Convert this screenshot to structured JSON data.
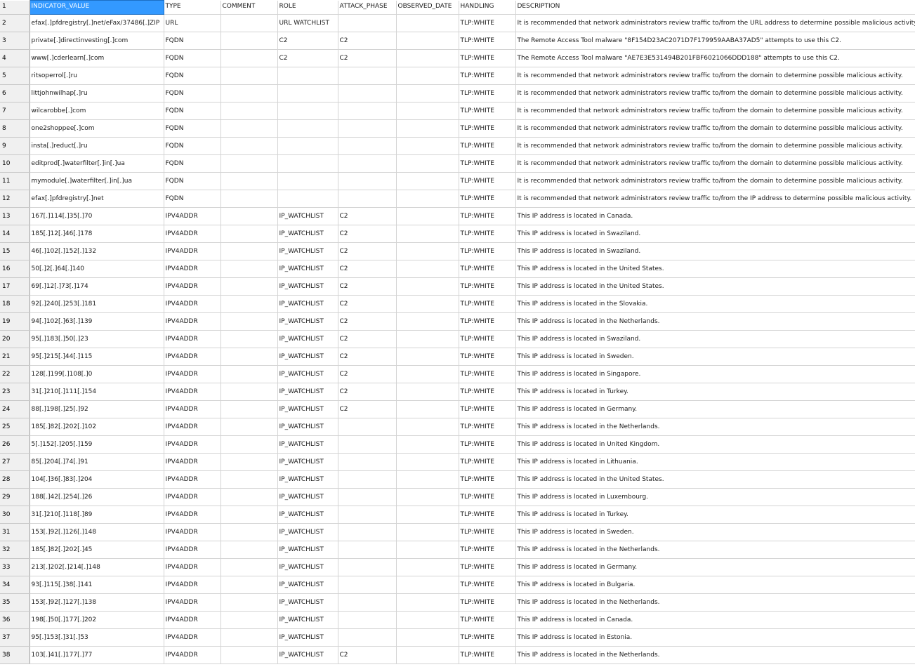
{
  "row_numbers": [
    "1",
    "2",
    "3",
    "4",
    "5",
    "6",
    "7",
    "8",
    "9",
    "10",
    "11",
    "12",
    "13",
    "14",
    "15",
    "16",
    "17",
    "18",
    "19",
    "20",
    "21",
    "22",
    "23",
    "24",
    "25",
    "26",
    "27",
    "28",
    "29",
    "30",
    "31",
    "32",
    "33",
    "34",
    "35",
    "36",
    "37",
    "38"
  ],
  "columns": [
    "INDICATOR_VALUE",
    "TYPE",
    "COMMENT",
    "ROLE",
    "ATTACK_PHASE",
    "OBSERVED_DATE",
    "HANDLING",
    "DESCRIPTION"
  ],
  "rows": [
    [
      "efax[.]pfdregistry[.]net/eFax/37486[.]ZIP",
      "URL",
      "",
      "URL WATCHLIST",
      "",
      "",
      "TLP:WHITE",
      "It is recommended that network administrators review traffic to/from the URL address to determine possible malicious activity."
    ],
    [
      "private[.]directinvesting[.]com",
      "FQDN",
      "",
      "C2",
      "C2",
      "",
      "TLP:WHITE",
      "The Remote Access Tool malware \"8F154D23AC2071D7F179959AABA37AD5\" attempts to use this C2."
    ],
    [
      "www[.]cderlearn[.]com",
      "FQDN",
      "",
      "C2",
      "C2",
      "",
      "TLP:WHITE",
      "The Remote Access Tool malware \"AE7E3E531494B201FBF6021066DDD188\" attempts to use this C2."
    ],
    [
      "ritsoperrol[.]ru",
      "FQDN",
      "",
      "",
      "",
      "",
      "TLP:WHITE",
      "It is recommended that network administrators review traffic to/from the domain to determine possible malicious activity."
    ],
    [
      "littjohnwilhap[.]ru",
      "FQDN",
      "",
      "",
      "",
      "",
      "TLP:WHITE",
      "It is recommended that network administrators review traffic to/from the domain to determine possible malicious activity."
    ],
    [
      "wilcarobbe[.]com",
      "FQDN",
      "",
      "",
      "",
      "",
      "TLP:WHITE",
      "It is recommended that network administrators review traffic to/from the domain to determine possible malicious activity."
    ],
    [
      "one2shoppee[.]com",
      "FQDN",
      "",
      "",
      "",
      "",
      "TLP:WHITE",
      "It is recommended that network administrators review traffic to/from the domain to determine possible malicious activity."
    ],
    [
      "insta[.]reduct[.]ru",
      "FQDN",
      "",
      "",
      "",
      "",
      "TLP:WHITE",
      "It is recommended that network administrators review traffic to/from the domain to determine possible malicious activity."
    ],
    [
      "editprod[.]waterfilter[.]in[.]ua",
      "FQDN",
      "",
      "",
      "",
      "",
      "TLP:WHITE",
      "It is recommended that network administrators review traffic to/from the domain to determine possible malicious activity."
    ],
    [
      "mymodule[.]waterfilter[.]in[.]ua",
      "FQDN",
      "",
      "",
      "",
      "",
      "TLP:WHITE",
      "It is recommended that network administrators review traffic to/from the domain to determine possible malicious activity."
    ],
    [
      "efax[.]pfdregistry[.]net",
      "FQDN",
      "",
      "",
      "",
      "",
      "TLP:WHITE",
      "It is recommended that network administrators review traffic to/from the IP address to determine possible malicious activity."
    ],
    [
      "167[.]114[.]35[.]70",
      "IPV4ADDR",
      "",
      "IP_WATCHLIST",
      "C2",
      "",
      "TLP:WHITE",
      "This IP address is located in Canada."
    ],
    [
      "185[.]12[.]46[.]178",
      "IPV4ADDR",
      "",
      "IP_WATCHLIST",
      "C2",
      "",
      "TLP:WHITE",
      "This IP address is located in Swaziland."
    ],
    [
      "46[.]102[.]152[.]132",
      "IPV4ADDR",
      "",
      "IP_WATCHLIST",
      "C2",
      "",
      "TLP:WHITE",
      "This IP address is located in Swaziland."
    ],
    [
      "50[.]2[.]64[.]140",
      "IPV4ADDR",
      "",
      "IP_WATCHLIST",
      "C2",
      "",
      "TLP:WHITE",
      "This IP address is located in the United States."
    ],
    [
      "69[.]12[.]73[.]174",
      "IPV4ADDR",
      "",
      "IP_WATCHLIST",
      "C2",
      "",
      "TLP:WHITE",
      "This IP address is located in the United States."
    ],
    [
      "92[.]240[.]253[.]181",
      "IPV4ADDR",
      "",
      "IP_WATCHLIST",
      "C2",
      "",
      "TLP:WHITE",
      "This IP address is located in the Slovakia."
    ],
    [
      "94[.]102[.]63[.]139",
      "IPV4ADDR",
      "",
      "IP_WATCHLIST",
      "C2",
      "",
      "TLP:WHITE",
      "This IP address is located in the Netherlands."
    ],
    [
      "95[.]183[.]50[.]23",
      "IPV4ADDR",
      "",
      "IP_WATCHLIST",
      "C2",
      "",
      "TLP:WHITE",
      "This IP address is located in Swaziland."
    ],
    [
      "95[.]215[.]44[.]115",
      "IPV4ADDR",
      "",
      "IP_WATCHLIST",
      "C2",
      "",
      "TLP:WHITE",
      "This IP address is located in Sweden."
    ],
    [
      "128[.]199[.]108[.]0",
      "IPV4ADDR",
      "",
      "IP_WATCHLIST",
      "C2",
      "",
      "TLP:WHITE",
      "This IP address is located in Singapore."
    ],
    [
      "31[.]210[.]111[.]154",
      "IPV4ADDR",
      "",
      "IP_WATCHLIST",
      "C2",
      "",
      "TLP:WHITE",
      "This IP address is located in Turkey."
    ],
    [
      "88[.]198[.]25[.]92",
      "IPV4ADDR",
      "",
      "IP_WATCHLIST",
      "C2",
      "",
      "TLP:WHITE",
      "This IP address is located in Germany."
    ],
    [
      "185[.]82[.]202[.]102",
      "IPV4ADDR",
      "",
      "IP_WATCHLIST",
      "",
      "",
      "TLP:WHITE",
      "This IP address is located in the Netherlands."
    ],
    [
      "5[.]152[.]205[.]159",
      "IPV4ADDR",
      "",
      "IP_WATCHLIST",
      "",
      "",
      "TLP:WHITE",
      "This IP address is located in United Kingdom."
    ],
    [
      "85[.]204[.]74[.]91",
      "IPV4ADDR",
      "",
      "IP_WATCHLIST",
      "",
      "",
      "TLP:WHITE",
      "This IP address is located in Lithuania."
    ],
    [
      "104[.]36[.]83[.]204",
      "IPV4ADDR",
      "",
      "IP_WATCHLIST",
      "",
      "",
      "TLP:WHITE",
      "This IP address is located in the United States."
    ],
    [
      "188[.]42[.]254[.]26",
      "IPV4ADDR",
      "",
      "IP_WATCHLIST",
      "",
      "",
      "TLP:WHITE",
      "This IP address is located in Luxembourg."
    ],
    [
      "31[.]210[.]118[.]89",
      "IPV4ADDR",
      "",
      "IP_WATCHLIST",
      "",
      "",
      "TLP:WHITE",
      "This IP address is located in Turkey."
    ],
    [
      "153[.]92[.]126[.]148",
      "IPV4ADDR",
      "",
      "IP_WATCHLIST",
      "",
      "",
      "TLP:WHITE",
      "This IP address is located in Sweden."
    ],
    [
      "185[.]82[.]202[.]45",
      "IPV4ADDR",
      "",
      "IP_WATCHLIST",
      "",
      "",
      "TLP:WHITE",
      "This IP address is located in the Netherlands."
    ],
    [
      "213[.]202[.]214[.]148",
      "IPV4ADDR",
      "",
      "IP_WATCHLIST",
      "",
      "",
      "TLP:WHITE",
      "This IP address is located in Germany."
    ],
    [
      "93[.]115[.]38[.]141",
      "IPV4ADDR",
      "",
      "IP_WATCHLIST",
      "",
      "",
      "TLP:WHITE",
      "This IP address is located in Bulgaria."
    ],
    [
      "153[.]92[.]127[.]138",
      "IPV4ADDR",
      "",
      "IP_WATCHLIST",
      "",
      "",
      "TLP:WHITE",
      "This IP address is located in the Netherlands."
    ],
    [
      "198[.]50[.]177[.]202",
      "IPV4ADDR",
      "",
      "IP_WATCHLIST",
      "",
      "",
      "TLP:WHITE",
      "This IP address is located in Canada."
    ],
    [
      "95[.]153[.]31[.]53",
      "IPV4ADDR",
      "",
      "IP_WATCHLIST",
      "",
      "",
      "TLP:WHITE",
      "This IP address is located in Estonia."
    ],
    [
      "103[.]41[.]177[.]77",
      "IPV4ADDR",
      "",
      "IP_WATCHLIST",
      "C2",
      "",
      "TLP:WHITE",
      "This IP address is located in the Netherlands."
    ]
  ],
  "colors": {
    "selected_cell_bg": "#3399ff",
    "selected_cell_text": "#ffffff",
    "row_header_bg": "#f0f0f0",
    "gridline": "#d4d4d4"
  }
}
